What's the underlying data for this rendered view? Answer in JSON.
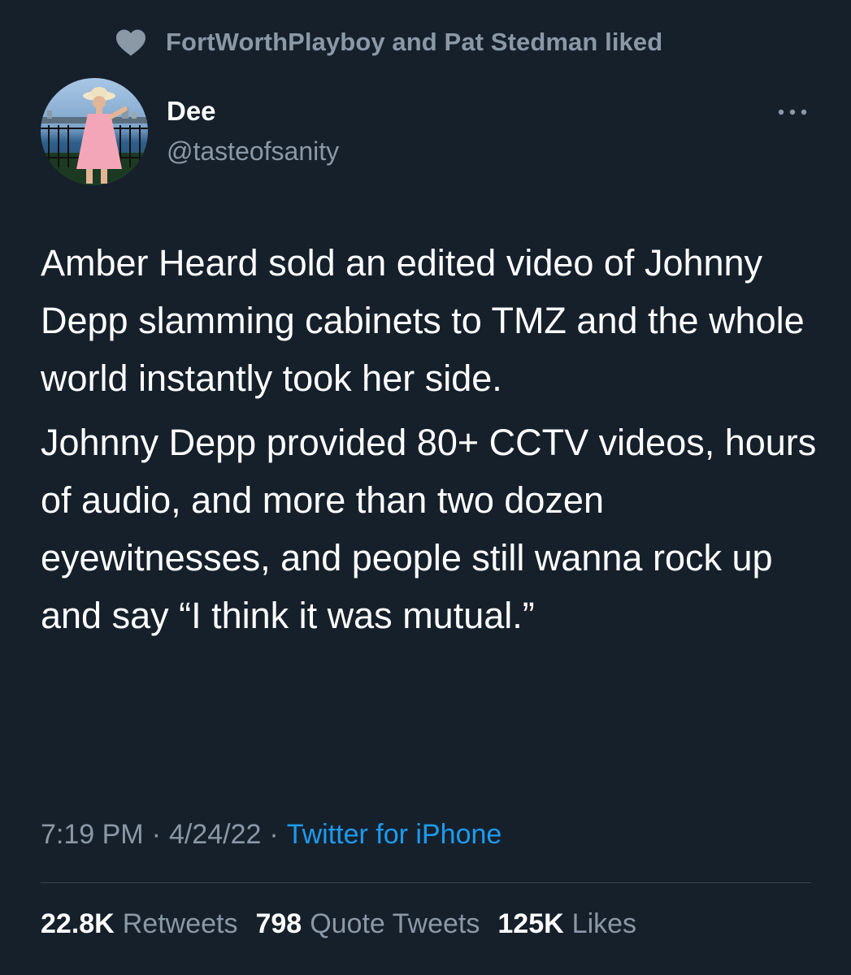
{
  "social_context": {
    "icon": "heart-icon",
    "text": "FortWorthPlayboy and Pat Stedman liked"
  },
  "author": {
    "name": "Dee",
    "handle": "@tasteofsanity"
  },
  "tweet": {
    "paragraphs": [
      "Amber Heard sold an edited video of Johnny Depp slamming cabinets to TMZ and the whole world instantly took her side.",
      "Johnny Depp provided 80+ CCTV videos, hours of audio, and more than two dozen eyewitnesses, and people still wanna rock up and say “I think it was mutual.”"
    ]
  },
  "meta": {
    "time": "7:19 PM",
    "separator": "·",
    "date": "4/24/22",
    "source": "Twitter for iPhone"
  },
  "stats": {
    "retweets_value": "22.8K",
    "retweets_label": "Retweets",
    "quotes_value": "798",
    "quotes_label": "Quote Tweets",
    "likes_value": "125K",
    "likes_label": "Likes"
  },
  "colors": {
    "background": "#15202b",
    "primary_text": "#ffffff",
    "secondary_text": "#8b98a5",
    "link": "#1d9bf0",
    "divider": "#38444d"
  }
}
